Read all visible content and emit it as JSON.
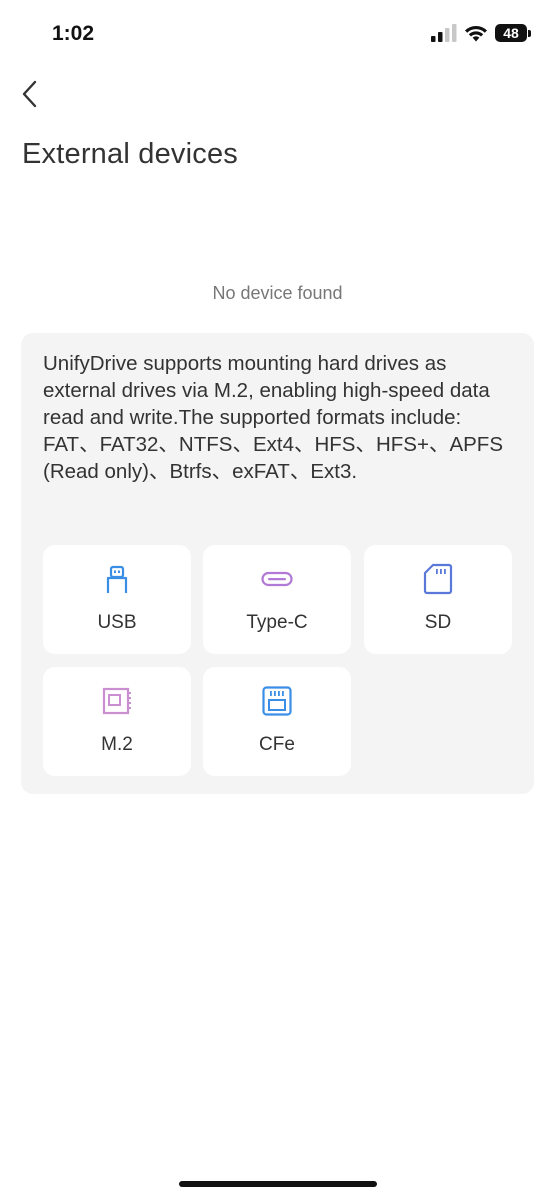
{
  "status_bar": {
    "time": "1:02",
    "battery": "48"
  },
  "header": {
    "title": "External devices"
  },
  "empty_state": "No device found",
  "info": {
    "description": "UnifyDrive supports mounting hard drives as external drives via M.2, enabling high-speed data read and write.The supported formats include: FAT、FAT32、NTFS、Ext4、HFS、HFS+、APFS (Read only)、Btrfs、exFAT、Ext3.",
    "devices": [
      {
        "label": "USB",
        "icon": "usb-icon",
        "color": "#3a8ee6"
      },
      {
        "label": "Type-C",
        "icon": "type-c-icon",
        "color": "#b07ad6"
      },
      {
        "label": "SD",
        "icon": "sd-card-icon",
        "color": "#5a78d8"
      },
      {
        "label": "M.2",
        "icon": "m2-icon",
        "color": "#c98fd0"
      },
      {
        "label": "CFe",
        "icon": "cfe-card-icon",
        "color": "#3a8ee6"
      }
    ]
  }
}
